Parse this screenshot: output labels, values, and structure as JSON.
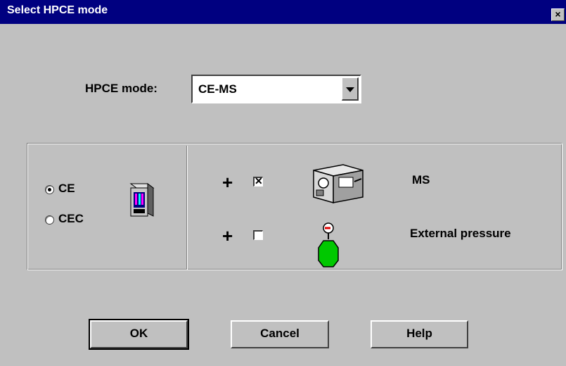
{
  "dialog": {
    "title": "Select HPCE mode",
    "close_glyph": "×"
  },
  "mode": {
    "label": "HPCE mode:",
    "selected": "CE-MS"
  },
  "separation": {
    "options": [
      {
        "label": "CE",
        "checked": true
      },
      {
        "label": "CEC",
        "checked": false
      }
    ],
    "icon": "ce-instrument-icon"
  },
  "addons": [
    {
      "plus": "+",
      "checked": true,
      "mark": "✕",
      "label": "MS",
      "icon": "ms-instrument-icon"
    },
    {
      "plus": "+",
      "checked": false,
      "mark": "",
      "label": "External pressure",
      "icon": "pressure-tank-icon"
    }
  ],
  "buttons": {
    "ok": "OK",
    "cancel": "Cancel",
    "help": "Help"
  },
  "colors": {
    "titlebar": "#000080",
    "face": "#c0c0c0",
    "pressure_tank": "#00c800"
  }
}
